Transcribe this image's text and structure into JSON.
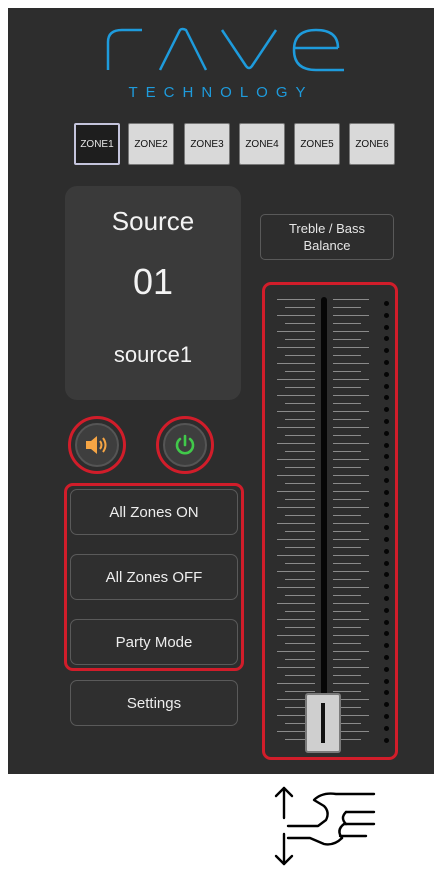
{
  "logo": {
    "word": "rave",
    "subtitle": "TECHNOLOGY"
  },
  "zones": [
    {
      "label": "ZONE1",
      "active": true
    },
    {
      "label": "ZONE2",
      "active": false
    },
    {
      "label": "ZONE3",
      "active": false
    },
    {
      "label": "ZONE4",
      "active": false
    },
    {
      "label": "ZONE5",
      "active": false
    },
    {
      "label": "ZONE6",
      "active": false
    }
  ],
  "source": {
    "title": "Source",
    "number": "01",
    "name": "source1"
  },
  "controls": {
    "volume_icon": "speaker-icon",
    "power_icon": "power-icon"
  },
  "buttons": {
    "all_on": "All Zones ON",
    "all_off": "All Zones OFF",
    "party": "Party Mode",
    "settings": "Settings"
  },
  "treble_bass": {
    "line1": "Treble / Bass",
    "line2": "Balance"
  },
  "slider": {
    "level": 0.0
  },
  "colors": {
    "brand": "#1e9bdc",
    "highlight": "#d11d2a",
    "power_green": "#41c94a",
    "volume_orange": "#f6a544"
  },
  "gesture_icon": "swipe-vertical-hand-icon"
}
